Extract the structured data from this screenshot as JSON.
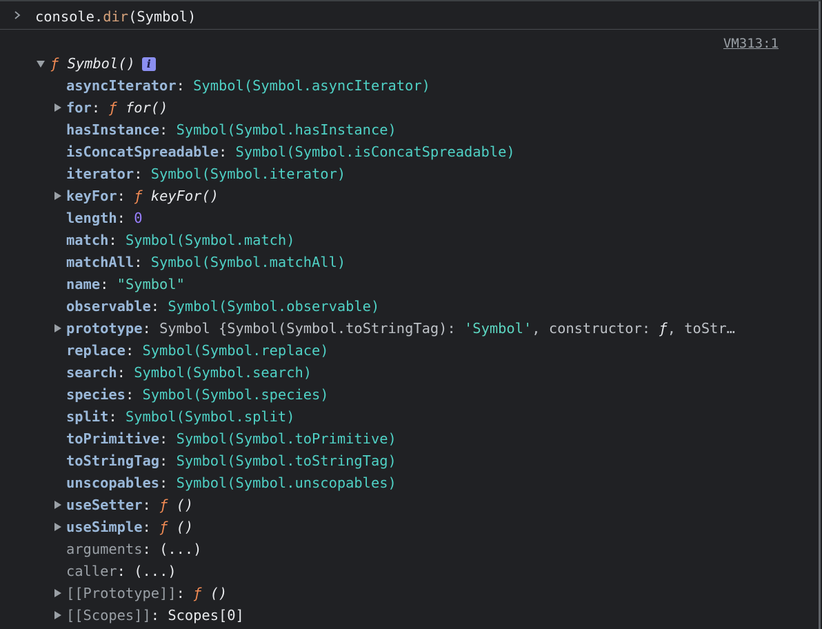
{
  "colors": {
    "background": "#202124",
    "property_key": "#9ab8d9",
    "symbol_value": "#4fd1c5",
    "number_value": "#9980ff",
    "function_f": "#f28b54",
    "method_name": "#d6a27b",
    "info_badge": "#8b8ff0",
    "link": "#9aa0a6"
  },
  "console_input": {
    "prompt_icon": "chevron-right-icon",
    "object_part": "console",
    "dot": ".",
    "method_part": "dir",
    "args_part": "(Symbol)"
  },
  "source_link": "VM313:1",
  "root": {
    "expanded": true,
    "f_label": "ƒ",
    "name": "Symbol()",
    "info_badge": "i",
    "info_icon": "info-icon"
  },
  "properties": [
    {
      "key": "asyncIterator",
      "sep": ": ",
      "value": "Symbol(Symbol.asyncIterator)",
      "kind": "symbol",
      "expandable": false
    },
    {
      "key": "for",
      "sep": ": ",
      "f": "ƒ",
      "value": "for()",
      "kind": "function",
      "expandable": true
    },
    {
      "key": "hasInstance",
      "sep": ": ",
      "value": "Symbol(Symbol.hasInstance)",
      "kind": "symbol",
      "expandable": false
    },
    {
      "key": "isConcatSpreadable",
      "sep": ": ",
      "value": "Symbol(Symbol.isConcatSpreadable)",
      "kind": "symbol",
      "expandable": false
    },
    {
      "key": "iterator",
      "sep": ": ",
      "value": "Symbol(Symbol.iterator)",
      "kind": "symbol",
      "expandable": false
    },
    {
      "key": "keyFor",
      "sep": ": ",
      "f": "ƒ",
      "value": "keyFor()",
      "kind": "function",
      "expandable": true
    },
    {
      "key": "length",
      "sep": ": ",
      "value": "0",
      "kind": "number",
      "expandable": false
    },
    {
      "key": "match",
      "sep": ": ",
      "value": "Symbol(Symbol.match)",
      "kind": "symbol",
      "expandable": false
    },
    {
      "key": "matchAll",
      "sep": ": ",
      "value": "Symbol(Symbol.matchAll)",
      "kind": "symbol",
      "expandable": false
    },
    {
      "key": "name",
      "sep": ": ",
      "value": "\"Symbol\"",
      "kind": "string",
      "expandable": false
    },
    {
      "key": "observable",
      "sep": ": ",
      "value": "Symbol(Symbol.observable)",
      "kind": "symbol",
      "expandable": false
    },
    {
      "key": "prototype",
      "sep": ": ",
      "value": "Symbol {Symbol(Symbol.toStringTag): 'Symbol', constructor: ƒ, toStr…",
      "kind": "object",
      "expandable": true,
      "preview": {
        "class_name": "Symbol ",
        "open": "{",
        "inner_key": "Symbol(Symbol.toStringTag)",
        "colon1": ": ",
        "inner_val": "'Symbol'",
        "comma1": ", ",
        "ctor_key": "constructor",
        "colon2": ": ",
        "ctor_val": "ƒ",
        "comma2": ", ",
        "tail": "toStr…"
      }
    },
    {
      "key": "replace",
      "sep": ": ",
      "value": "Symbol(Symbol.replace)",
      "kind": "symbol",
      "expandable": false
    },
    {
      "key": "search",
      "sep": ": ",
      "value": "Symbol(Symbol.search)",
      "kind": "symbol",
      "expandable": false
    },
    {
      "key": "species",
      "sep": ": ",
      "value": "Symbol(Symbol.species)",
      "kind": "symbol",
      "expandable": false
    },
    {
      "key": "split",
      "sep": ": ",
      "value": "Symbol(Symbol.split)",
      "kind": "symbol",
      "expandable": false
    },
    {
      "key": "toPrimitive",
      "sep": ": ",
      "value": "Symbol(Symbol.toPrimitive)",
      "kind": "symbol",
      "expandable": false
    },
    {
      "key": "toStringTag",
      "sep": ": ",
      "value": "Symbol(Symbol.toStringTag)",
      "kind": "symbol",
      "expandable": false
    },
    {
      "key": "unscopables",
      "sep": ": ",
      "value": "Symbol(Symbol.unscopables)",
      "kind": "symbol",
      "expandable": false
    },
    {
      "key": "useSetter",
      "sep": ": ",
      "f": "ƒ",
      "value": "()",
      "kind": "function",
      "expandable": true
    },
    {
      "key": "useSimple",
      "sep": ": ",
      "f": "ƒ",
      "value": "()",
      "kind": "function",
      "expandable": true
    },
    {
      "key": "arguments",
      "sep": ": ",
      "value": "(...)",
      "kind": "accessor",
      "expandable": false,
      "dim": true
    },
    {
      "key": "caller",
      "sep": ": ",
      "value": "(...)",
      "kind": "accessor",
      "expandable": false,
      "dim": true
    },
    {
      "key": "[[Prototype]]",
      "sep": ": ",
      "f": "ƒ",
      "value": "()",
      "kind": "function",
      "expandable": true,
      "dim": true
    },
    {
      "key": "[[Scopes]]",
      "sep": ": ",
      "value": "Scopes[0]",
      "kind": "internal",
      "expandable": true,
      "dim": true
    }
  ]
}
